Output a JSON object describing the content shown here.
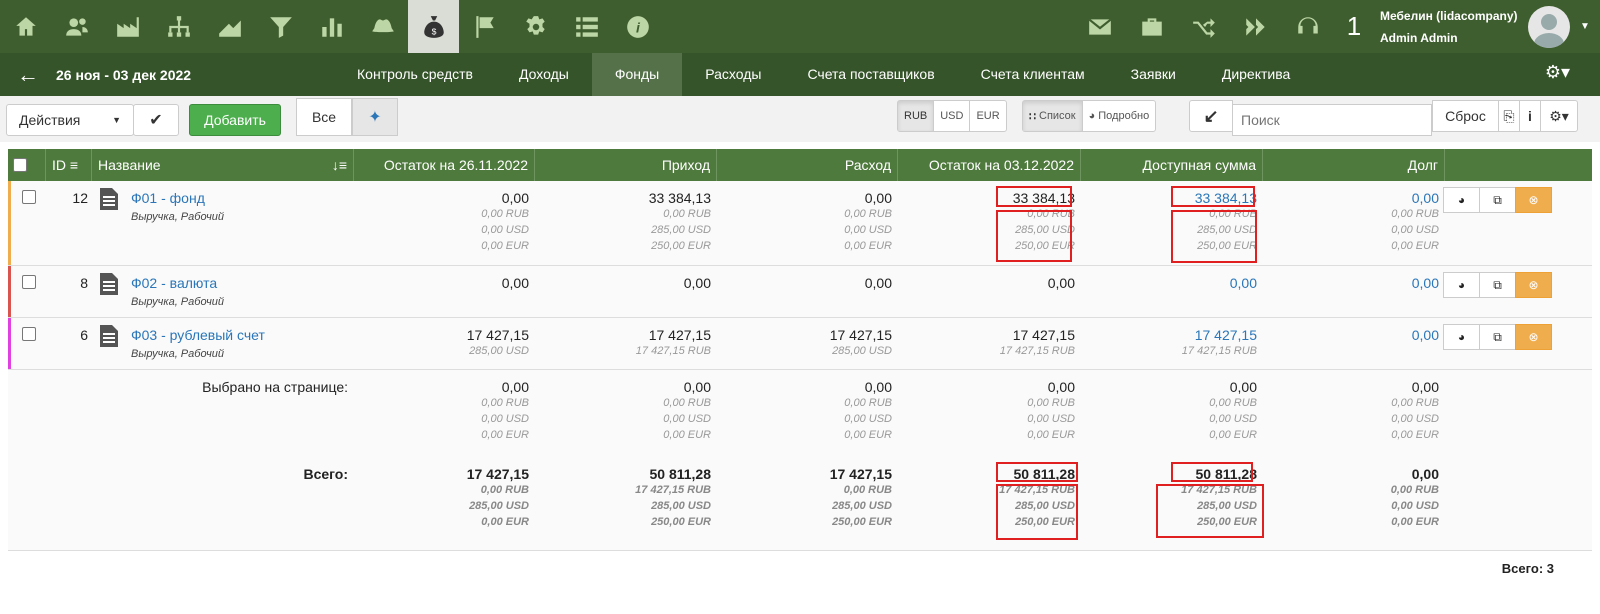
{
  "topnav": {
    "icons": [
      "home-icon",
      "users-icon",
      "factory-icon",
      "org-chart-icon",
      "area-chart-icon",
      "funnel-icon",
      "bar-chart-icon",
      "hat-icon",
      "money-bag-icon",
      "flag-icon",
      "gear-icon",
      "list-icon",
      "info-icon"
    ],
    "active": "money-bag-icon"
  },
  "topright": {
    "icons": [
      "envelope-icon",
      "briefcase-icon",
      "shuffle-icon",
      "double-chevron-icon",
      "headset-icon"
    ],
    "notif_count": "1",
    "company": "Мебелин (lidacompany)",
    "user": "Admin Admin"
  },
  "nav": {
    "period": "26 ноя - 03 дек 2022",
    "tabs": [
      "Контроль средств",
      "Доходы",
      "Фонды",
      "Расходы",
      "Счета поставщиков",
      "Счета клиентам",
      "Заявки",
      "Директива"
    ],
    "active_tab": "Фонды"
  },
  "toolbar": {
    "actions": "Действия",
    "add": "Добавить",
    "filter_all": "Все",
    "currencies": [
      "RUB",
      "USD",
      "EUR"
    ],
    "active_currency": "RUB",
    "view_list": "Список",
    "view_detail": "Подробно",
    "search_placeholder": "Поиск",
    "reset": "Сброс"
  },
  "columns": {
    "id": "ID",
    "name": "Название",
    "start": "Остаток на 26.11.2022",
    "income": "Приход",
    "expense": "Расход",
    "end": "Остаток на 03.12.2022",
    "available": "Доступная сумма",
    "debt": "Долг"
  },
  "rows": [
    {
      "id": "12",
      "name": "Ф01 - фонд",
      "tags": "Выручка, Рабочий",
      "stripe": "#f0ad4e",
      "start": {
        "v": "0,00",
        "sub": [
          "0,00 RUB",
          "0,00 USD",
          "0,00 EUR"
        ]
      },
      "income": {
        "v": "33 384,13",
        "sub": [
          "0,00 RUB",
          "285,00 USD",
          "250,00 EUR"
        ]
      },
      "expense": {
        "v": "0,00",
        "sub": [
          "0,00 RUB",
          "0,00 USD",
          "0,00 EUR"
        ]
      },
      "end": {
        "v": "33 384,13",
        "sub": [
          "0,00 RUB",
          "285,00 USD",
          "250,00 EUR"
        ]
      },
      "available": {
        "v": "33 384,13",
        "sub": [
          "0,00 RUB",
          "285,00 USD",
          "250,00 EUR"
        ]
      },
      "debt": {
        "v": "0,00",
        "sub": [
          "0,00 RUB",
          "0,00 USD",
          "0,00 EUR"
        ]
      }
    },
    {
      "id": "8",
      "name": "Ф02 - валюта",
      "tags": "Выручка, Рабочий",
      "stripe": "#d9534f",
      "start": {
        "v": "0,00",
        "sub": []
      },
      "income": {
        "v": "0,00",
        "sub": []
      },
      "expense": {
        "v": "0,00",
        "sub": []
      },
      "end": {
        "v": "0,00",
        "sub": []
      },
      "available": {
        "v": "0,00",
        "sub": []
      },
      "debt": {
        "v": "0,00",
        "sub": []
      }
    },
    {
      "id": "6",
      "name": "Ф03 - рублевый счет",
      "tags": "Выручка, Рабочий",
      "stripe": "#e040e0",
      "start": {
        "v": "17 427,15",
        "sub": [
          "285,00 USD"
        ]
      },
      "income": {
        "v": "17 427,15",
        "sub": [
          "17 427,15 RUB"
        ]
      },
      "expense": {
        "v": "17 427,15",
        "sub": [
          "285,00 USD"
        ]
      },
      "end": {
        "v": "17 427,15",
        "sub": [
          "17 427,15 RUB"
        ]
      },
      "available": {
        "v": "17 427,15",
        "sub": [
          "17 427,15 RUB"
        ]
      },
      "debt": {
        "v": "0,00",
        "sub": []
      }
    }
  ],
  "selected": {
    "label": "Выбрано на странице:",
    "start": {
      "v": "0,00",
      "sub": [
        "0,00 RUB",
        "0,00 USD",
        "0,00 EUR"
      ]
    },
    "income": {
      "v": "0,00",
      "sub": [
        "0,00 RUB",
        "0,00 USD",
        "0,00 EUR"
      ]
    },
    "expense": {
      "v": "0,00",
      "sub": [
        "0,00 RUB",
        "0,00 USD",
        "0,00 EUR"
      ]
    },
    "end": {
      "v": "0,00",
      "sub": [
        "0,00 RUB",
        "0,00 USD",
        "0,00 EUR"
      ]
    },
    "available": {
      "v": "0,00",
      "sub": [
        "0,00 RUB",
        "0,00 USD",
        "0,00 EUR"
      ]
    },
    "debt": {
      "v": "0,00",
      "sub": [
        "0,00 RUB",
        "0,00 USD",
        "0,00 EUR"
      ]
    }
  },
  "total": {
    "label": "Всего:",
    "start": {
      "v": "17 427,15",
      "sub": [
        "0,00 RUB",
        "285,00 USD",
        "0,00 EUR"
      ]
    },
    "income": {
      "v": "50 811,28",
      "sub": [
        "17 427,15 RUB",
        "285,00 USD",
        "250,00 EUR"
      ]
    },
    "expense": {
      "v": "17 427,15",
      "sub": [
        "0,00 RUB",
        "285,00 USD",
        "250,00 EUR"
      ]
    },
    "end": {
      "v": "50 811,28",
      "sub": [
        "17 427,15 RUB",
        "285,00 USD",
        "250,00 EUR"
      ]
    },
    "available": {
      "v": "50 811,28",
      "sub": [
        "17 427,15 RUB",
        "285,00 USD",
        "250,00 EUR"
      ]
    },
    "debt": {
      "v": "0,00",
      "sub": [
        "0,00 RUB",
        "0,00 USD",
        "0,00 EUR"
      ]
    }
  },
  "footer": {
    "count": "Всего: 3"
  }
}
